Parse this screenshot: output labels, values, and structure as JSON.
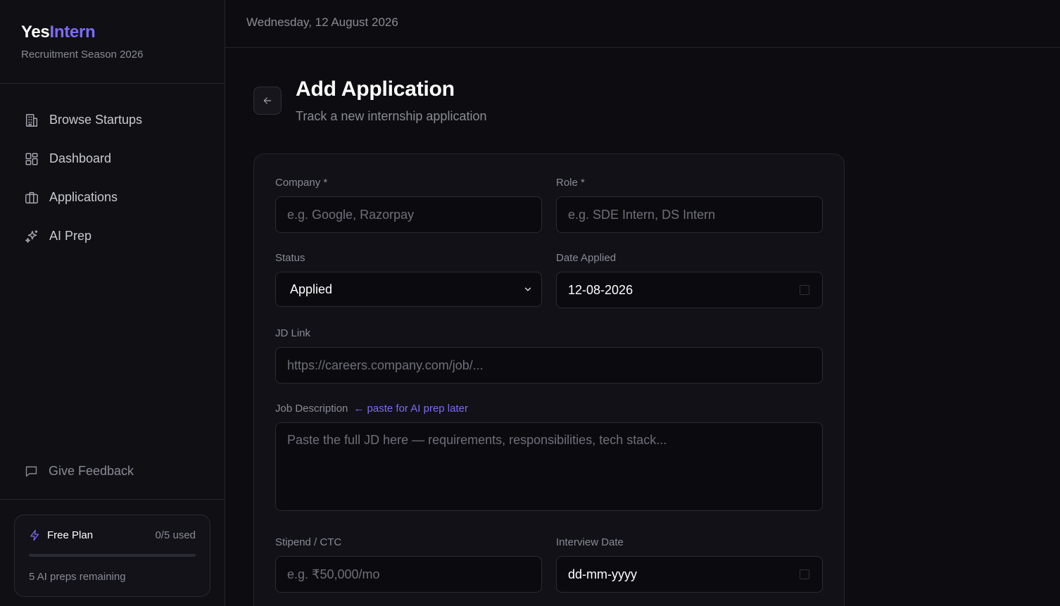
{
  "brand": {
    "name_part1": "Yes",
    "name_part2": "Intern",
    "subtitle": "Recruitment Season 2026",
    "accent_color": "#7c6cf6"
  },
  "sidebar": {
    "items": [
      {
        "label": "Browse Startups",
        "icon": "building-icon"
      },
      {
        "label": "Dashboard",
        "icon": "grid-icon"
      },
      {
        "label": "Applications",
        "icon": "briefcase-icon"
      },
      {
        "label": "AI Prep",
        "icon": "sparkles-icon"
      }
    ],
    "feedback_label": "Give Feedback"
  },
  "plan": {
    "title": "Free Plan",
    "used": "0/5 used",
    "progress_fraction": 0,
    "remaining": "5 AI preps remaining"
  },
  "header": {
    "date": "Wednesday, 12 August 2026"
  },
  "page": {
    "title": "Add Application",
    "subtitle": "Track a new internship application"
  },
  "form": {
    "company": {
      "label": "Company *",
      "placeholder": "e.g. Google, Razorpay"
    },
    "role": {
      "label": "Role *",
      "placeholder": "e.g. SDE Intern, DS Intern"
    },
    "status": {
      "label": "Status",
      "value": "Applied"
    },
    "date_applied": {
      "label": "Date Applied",
      "value": "12-08-2026"
    },
    "jd_link": {
      "label": "JD Link",
      "placeholder": "https://careers.company.com/job/..."
    },
    "job_description": {
      "label": "Job Description",
      "hint": "← paste for AI prep later",
      "placeholder": "Paste the full JD here — requirements, responsibilities, tech stack..."
    },
    "stipend": {
      "label": "Stipend / CTC",
      "placeholder": "e.g. ₹50,000/mo"
    },
    "interview_date": {
      "label": "Interview Date",
      "value": "dd-mm-yyyy"
    }
  }
}
